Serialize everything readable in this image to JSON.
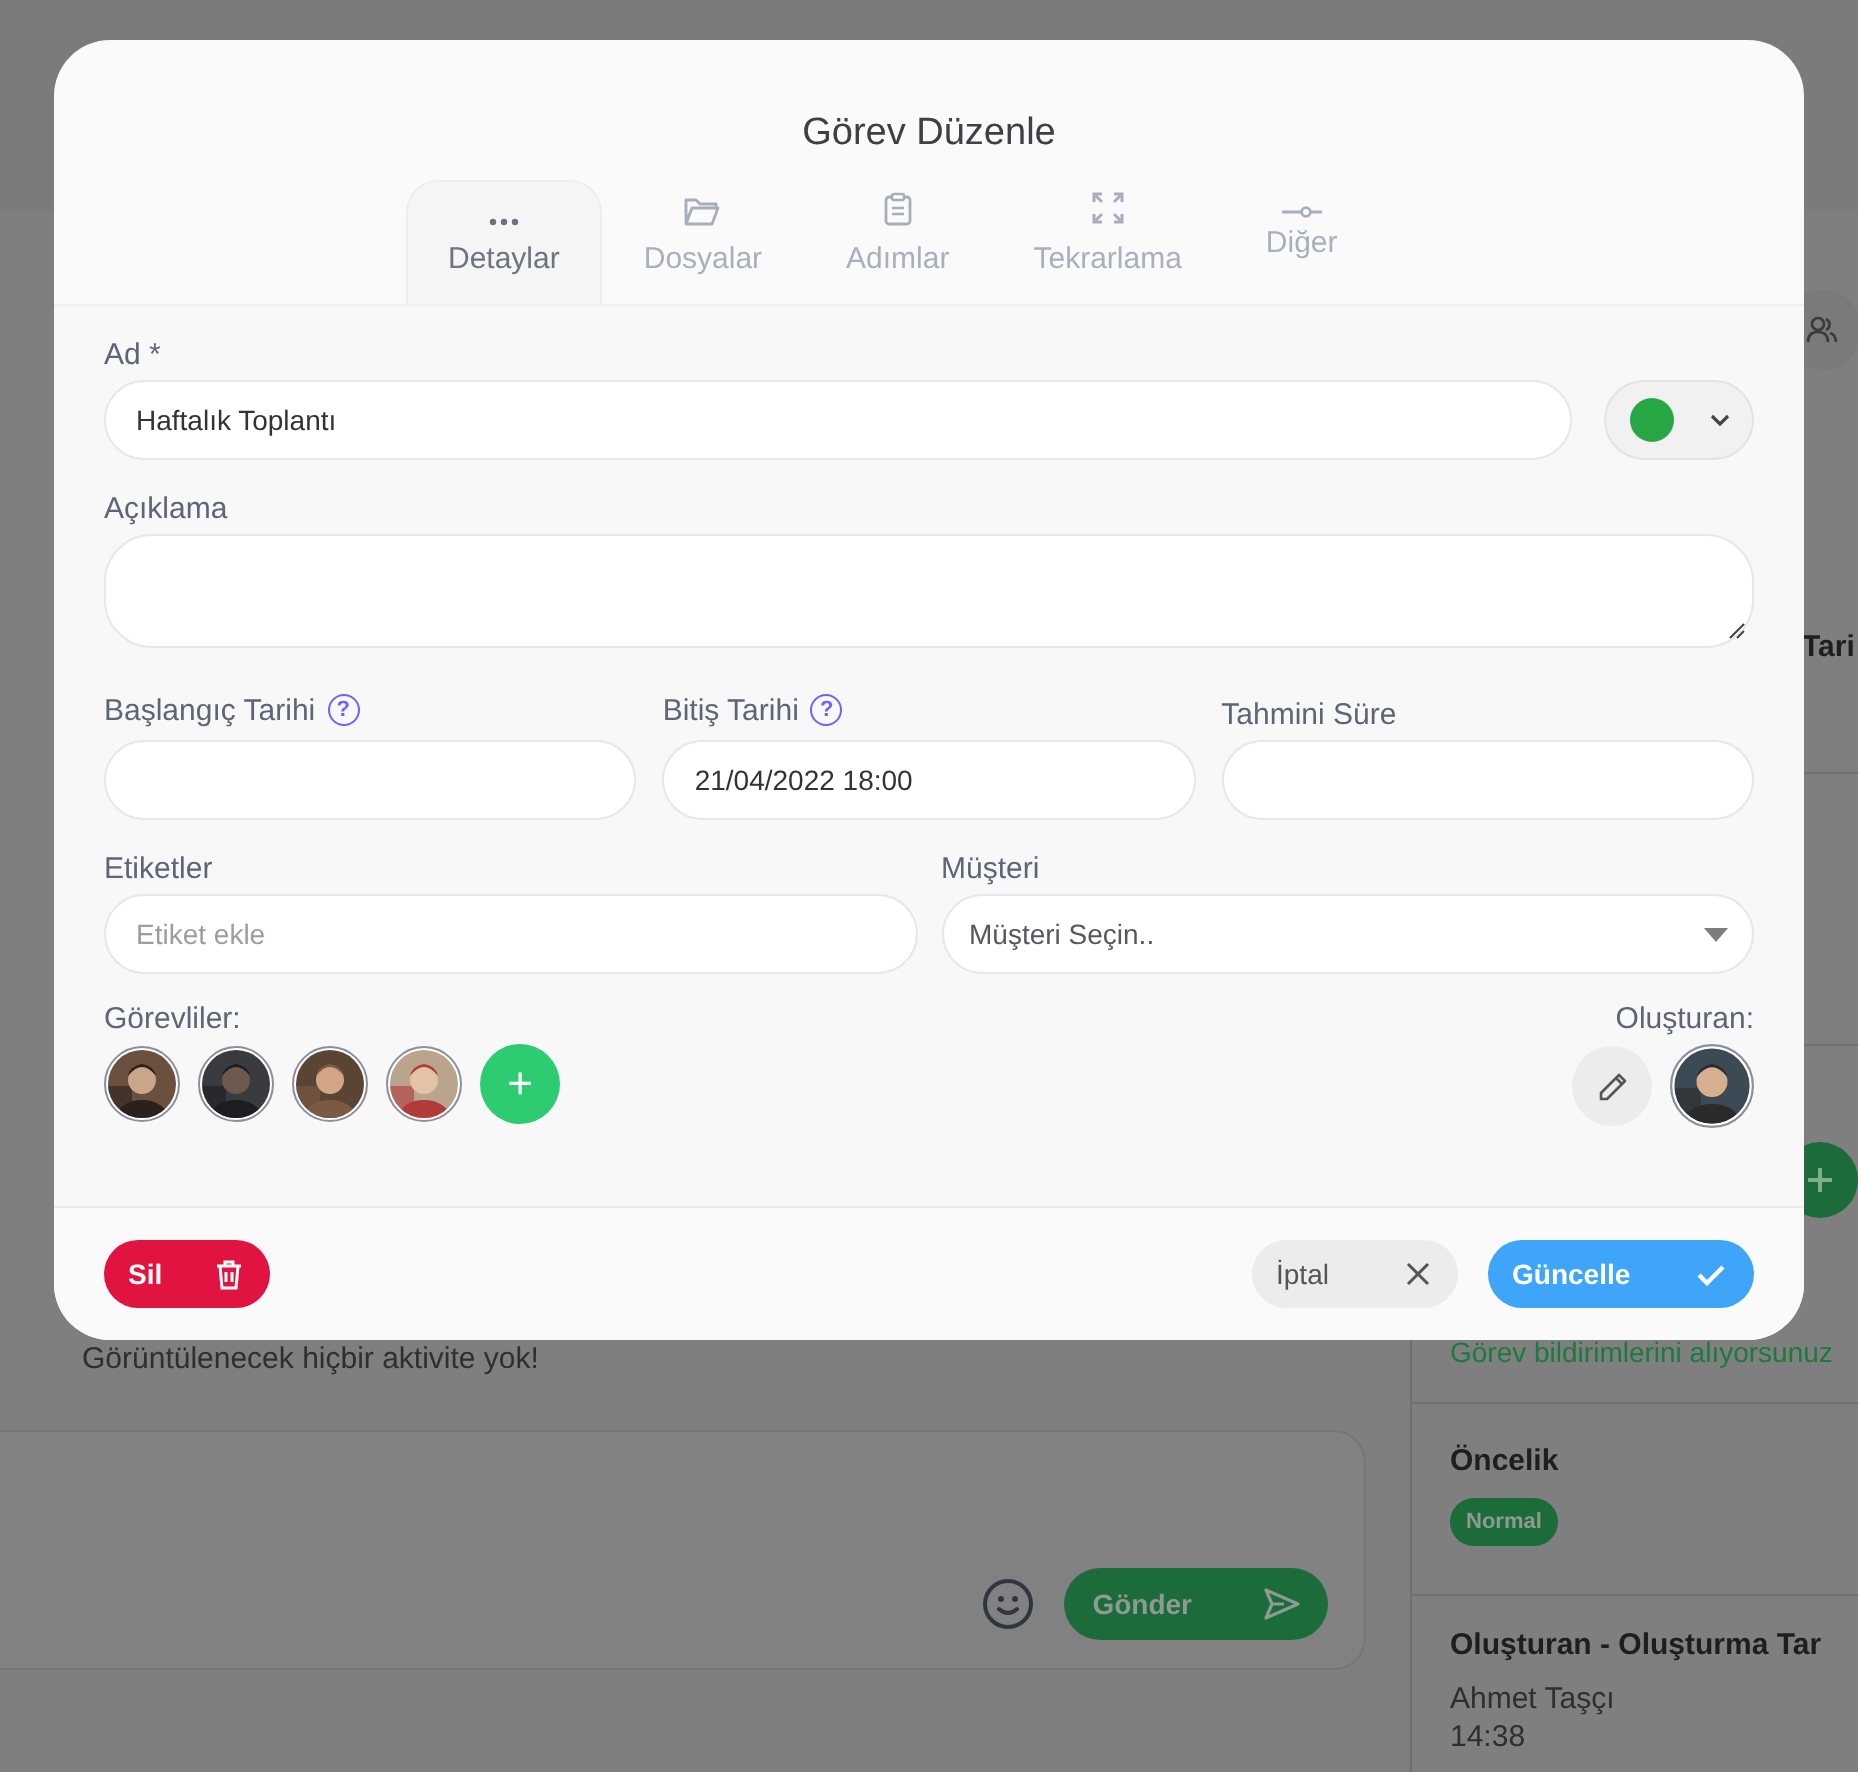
{
  "background": {
    "activity_empty": "Görüntülenecek hiçbir aktivite yok!",
    "send_button": "Gönder",
    "side_panel": {
      "heading": "Tari",
      "notification": "Görev bildirimlerini alıyorsunuz",
      "priority_label": "Öncelik",
      "priority_badge": "Normal",
      "creator_heading": "Oluşturan - Oluşturma Tar",
      "creator_name": "Ahmet Taşçı",
      "created_time": "14:38"
    }
  },
  "dialog": {
    "title": "Görev Düzenle",
    "tabs": [
      {
        "label": "Detaylar",
        "selected": true
      },
      {
        "label": "Dosyalar",
        "selected": false
      },
      {
        "label": "Adımlar",
        "selected": false
      },
      {
        "label": "Tekrarlama",
        "selected": false
      },
      {
        "label": "Diğer",
        "selected": false
      }
    ],
    "name": {
      "label": "Ad *",
      "value": "Haftalık Toplantı"
    },
    "color_picker": {
      "color": "#28a745"
    },
    "description": {
      "label": "Açıklama"
    },
    "start_date": {
      "label": "Başlangıç Tarihi",
      "help": "?"
    },
    "end_date": {
      "label": "Bitiş Tarihi",
      "help": "?",
      "value": "21/04/2022 18:00"
    },
    "estimate": {
      "label": "Tahmini Süre"
    },
    "tags": {
      "label": "Etiketler",
      "placeholder": "Etiket ekle"
    },
    "customer": {
      "label": "Müşteri",
      "placeholder": "Müşteri Seçin.."
    },
    "assignees": {
      "label": "Görevliler:",
      "add_button": "+"
    },
    "creator": {
      "label": "Oluşturan:"
    },
    "delete_button": "Sil",
    "cancel_button": "İptal",
    "update_button": "Güncelle"
  }
}
